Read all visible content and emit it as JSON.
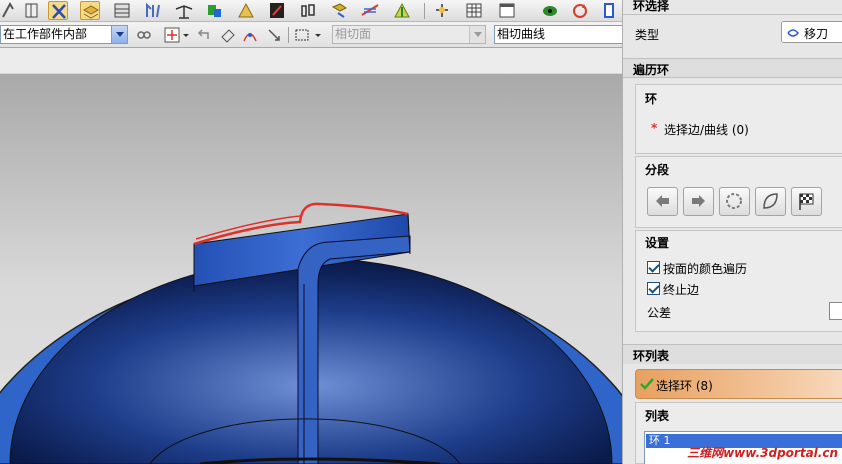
{
  "toolbar": {
    "scope_combo": "在工作部件内部",
    "face_rule_combo": "相切面",
    "curve_rule_combo": "相切曲线"
  },
  "panel": {
    "top_section_title": "环选择",
    "type_label": "类型",
    "type_value": "移刀",
    "traverse_title": "遍历环",
    "loop_group_title": "环",
    "select_edge_star": "*",
    "select_edge_label": "选择边/曲线 (0)",
    "segment_title": "分段",
    "settings_title": "设置",
    "checkbox_face_color": "按面的颜色遍历",
    "checkbox_stop_edge": "终止边",
    "tolerance_label": "公差",
    "loop_list_title": "环列表",
    "select_loop_label": "选择环 (8)",
    "list_title": "列表",
    "list_item": "环 1"
  },
  "watermark": "三维网www.3dportal.cn",
  "colors": {
    "part_blue": "#2f64c8",
    "edge_red": "#e0302a",
    "select_orange": "#e8a060",
    "check_green": "#2ea82e"
  },
  "icons": [
    "rotate-view-icon",
    "fit-icon",
    "cut-tool-icon",
    "layer-icon",
    "table-icon",
    "scale-icon",
    "snap-icon",
    "color-icon",
    "select-icon",
    "edge-select-icon",
    "face-select-icon",
    "filter-icon",
    "plane-icon",
    "grid-icon",
    "window-icon",
    "refresh-icon",
    "info-icon",
    "move-icon",
    "prev-segment-icon",
    "next-segment-icon",
    "cycle-segment-icon",
    "close-segment-icon",
    "finish-flag-icon",
    "link-icon",
    "curve-icon",
    "undo-icon",
    "eraser-icon",
    "arrow-move-icon",
    "point-icon",
    "rectangle-select-icon"
  ]
}
